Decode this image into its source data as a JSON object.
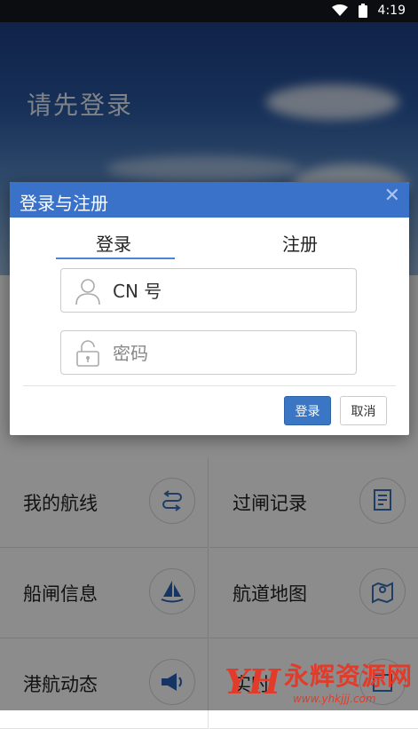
{
  "status_bar": {
    "time": "4:19"
  },
  "hero": {
    "title": "请先登录"
  },
  "menu": {
    "items": [
      {
        "label": "我的航线",
        "icon": "route-icon"
      },
      {
        "label": "过闸记录",
        "icon": "receipt-icon"
      },
      {
        "label": "船闸信息",
        "icon": "sailboat-icon"
      },
      {
        "label": "航道地图",
        "icon": "map-icon"
      },
      {
        "label": "港航动态",
        "icon": "megaphone-icon"
      },
      {
        "label": "实时",
        "icon": "calendar-icon"
      }
    ]
  },
  "dialog": {
    "title": "登录与注册",
    "close_symbol": "✕",
    "tabs": {
      "login": "登录",
      "register": "注册"
    },
    "cn_field": {
      "placeholder": "CN 号",
      "value": ""
    },
    "password_field": {
      "placeholder": "密码",
      "value": ""
    },
    "login_button": "登录",
    "cancel_button": "取消"
  },
  "watermark": {
    "main": "永辉资源网",
    "sub": "www.yhkjjj.com"
  },
  "colors": {
    "accent": "#3b72c9",
    "watermark": "#e23b2a"
  }
}
